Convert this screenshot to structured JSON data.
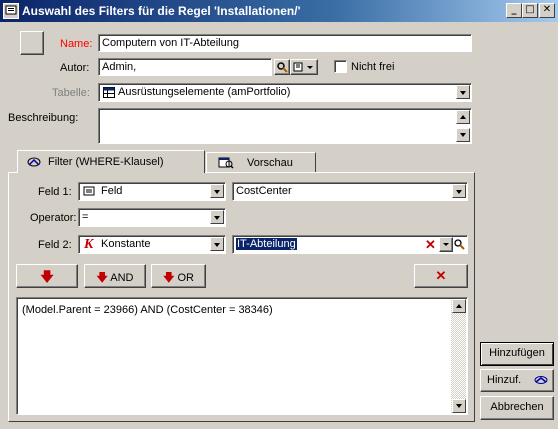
{
  "window": {
    "title": "Auswahl des Filters für die Regel 'Installationen/'",
    "minimize": "_",
    "maximize": "□",
    "close": "✕"
  },
  "form": {
    "name_label": "Name:",
    "name_value": "Computern von IT-Abteilung",
    "author_label": "Autor:",
    "author_value": "Admin,",
    "not_free_label": "Nicht frei",
    "table_label": "Tabelle:",
    "table_value": "Ausrüstungselemente (amPortfolio)",
    "description_label": "Beschreibung:",
    "description_value": ""
  },
  "tabs": [
    {
      "label": "Filter (WHERE-Klausel)",
      "active": true
    },
    {
      "label": "Vorschau",
      "active": false
    }
  ],
  "filter": {
    "field1_label": "Feld 1:",
    "field1_type": "Feld",
    "field1_value": "CostCenter",
    "operator_label": "Operator:",
    "operator_value": "=",
    "field2_label": "Feld 2:",
    "field2_type": "Konstante",
    "field2_value": "IT-Abteilung",
    "and_label": "AND",
    "or_label": "OR",
    "clause": "(Model.Parent = 23966) AND (CostCenter = 38346)"
  },
  "buttons": {
    "add": "Hinzufügen",
    "add_plus": "Hinzuf.",
    "cancel": "Abbrechen"
  },
  "colors": {
    "titlebar_start": "#0a246a",
    "titlebar_end": "#a6caf0",
    "name_label": "#ff0000",
    "selection": "#0a246a",
    "arrow_red": "#c00000"
  }
}
